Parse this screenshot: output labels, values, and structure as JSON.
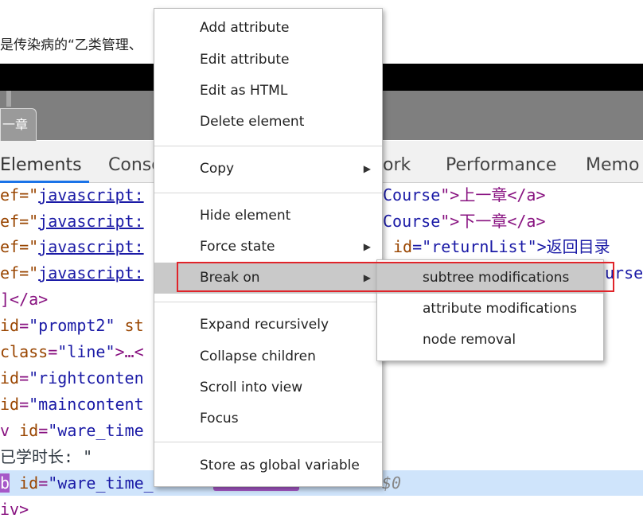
{
  "page": {
    "top_text": "是传染病的“乙类管理、",
    "chapter_tab": "一章"
  },
  "devtools": {
    "tabs": [
      "Elements",
      "Conso",
      "ork",
      "Performance",
      "Memo"
    ],
    "code_lines": [
      {
        "pre": "ef=\"",
        "link": "javascript:",
        "mid": "",
        "rest_attr": "Course",
        "rest": "\">上一章</a>"
      },
      {
        "pre": "ef=\"",
        "link": "javascript:",
        "mid": "",
        "rest_attr": "Course",
        "rest": "\">下一章</a>"
      },
      {
        "pre": "ef=\"",
        "link": "javascript:",
        "mid": "",
        "rest_attr": "id",
        "rest": "=\"returnList\">返回目录"
      },
      {
        "pre": "ef=\"",
        "link": "javascript:",
        "mid": "",
        "rest_attr": "urse",
        "rest": ""
      }
    ],
    "line5": "]</a>",
    "line6_attr": "id",
    "line6_val": "\"prompt2\"",
    "line6_tail": " st",
    "line7_attr": "class",
    "line7_val": "\"line\"",
    "line7_tail": ">…<",
    "line8_attr": "id",
    "line8_val": "\"rightconten",
    "line9_attr": "id",
    "line9_val": "\"maincontent",
    "line10_pre": "v ",
    "line10_attr": "id",
    "line10_val": "\"ware_time",
    "line11": "已学时长: \"",
    "line12_tag": "b",
    "line12_attr": "id",
    "line12_val": "\"ware_time_",
    "line12_eq": "$0",
    "line13": "iv>"
  },
  "context_menu": {
    "items": [
      "Add attribute",
      "Edit attribute",
      "Edit as HTML",
      "Delete element",
      "Copy",
      "Hide element",
      "Force state",
      "Break on",
      "Expand recursively",
      "Collapse children",
      "Scroll into view",
      "Focus",
      "Store as global variable"
    ],
    "highlighted": "Break on"
  },
  "submenu": {
    "items": [
      "subtree modifications",
      "attribute modifications",
      "node removal"
    ],
    "highlighted": "subtree modifications"
  },
  "colors": {
    "highlight_box": "#e0242a",
    "menu_highlight": "#c9c9c9",
    "selected_row": "#cfe4fb"
  }
}
